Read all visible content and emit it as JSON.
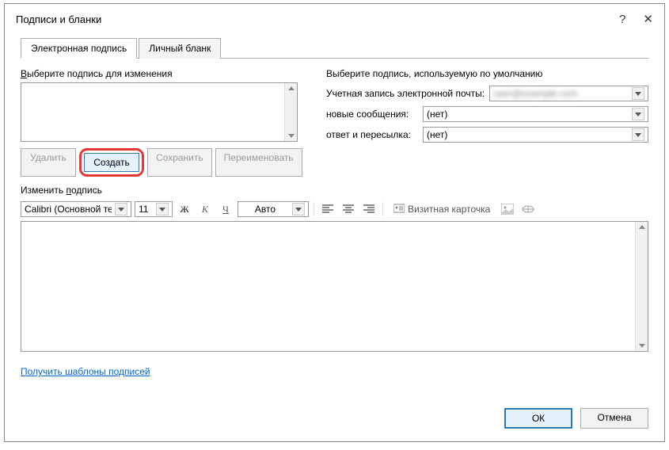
{
  "dialog": {
    "title": "Подписи и бланки",
    "tabs": {
      "signature": "Электронная подпись",
      "stationery": "Личный бланк"
    }
  },
  "left": {
    "select_label": "Выберите подпись для изменения",
    "buttons": {
      "delete": "Удалить",
      "create": "Создать",
      "save": "Сохранить",
      "rename": "Переименовать"
    }
  },
  "right": {
    "heading": "Выберите подпись, используемую по умолчанию",
    "account_label": "Учетная запись электронной почты:",
    "account_value": "user@example.com",
    "new_label": "новые сообщения:",
    "new_value": "(нет)",
    "reply_label": "ответ и пересылка:",
    "reply_value": "(нет)"
  },
  "edit": {
    "label_prefix": "Изменить ",
    "label_ul": "п",
    "label_rest": "одпись",
    "font": "Calibri (Основной те",
    "size": "11",
    "bold": "Ж",
    "italic": "К",
    "underline": "Ч",
    "autocolor": "Авто",
    "business_card": "Визитная карточка"
  },
  "footer_link": "Получить шаблоны подписей",
  "buttons": {
    "ok": "ОК",
    "cancel": "Отмена"
  }
}
